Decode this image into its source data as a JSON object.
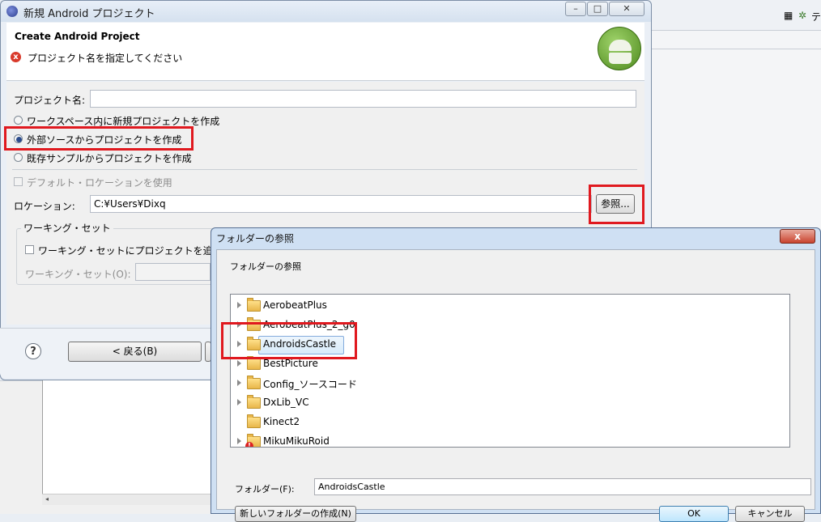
{
  "android_dialog": {
    "window_title": "新規 Android プロジェクト",
    "header_title": "Create Android Project",
    "header_error": "プロジェクト名を指定してください",
    "project_name_label": "プロジェクト名:",
    "project_name_value": "",
    "radio_options": [
      {
        "label": "ワークスペース内に新規プロジェクトを作成",
        "selected": false
      },
      {
        "label": "外部ソースからプロジェクトを作成",
        "selected": true
      },
      {
        "label": "既存サンプルからプロジェクトを作成",
        "selected": false
      }
    ],
    "use_default_location_label": "デフォルト・ロケーションを使用",
    "location_label": "ロケーション:",
    "location_value": "C:¥Users¥Dixq",
    "browse_button": "参照...",
    "working_set_group": "ワーキング・セット",
    "working_set_add_label": "ワーキング・セットにプロジェクトを追",
    "working_set_field_label": "ワーキング・セット(O):",
    "back_button": "< 戻る(B)",
    "window_buttons": {
      "minimize": "–",
      "maximize": "□",
      "close": "✕"
    }
  },
  "folder_dialog": {
    "window_title": "フォルダーの参照",
    "close_button": "x",
    "prompt": "フォルダーの参照",
    "tree_items": [
      {
        "label": "AerobeatPlus",
        "expandable": true,
        "selected": false
      },
      {
        "label": "AerobeatPlus_2_g0",
        "expandable": true,
        "selected": false
      },
      {
        "label": "AndroidsCastle",
        "expandable": true,
        "selected": true
      },
      {
        "label": "BestPicture",
        "expandable": true,
        "selected": false
      },
      {
        "label": "Config_ソースコード",
        "expandable": true,
        "selected": false
      },
      {
        "label": "DxLib_VC",
        "expandable": true,
        "selected": false
      },
      {
        "label": "Kinect2",
        "expandable": false,
        "selected": false
      },
      {
        "label": "MikuMikuRoid",
        "expandable": true,
        "selected": false
      }
    ],
    "folder_label": "フォルダー(F):",
    "folder_value": "AndroidsCastle",
    "new_folder_button": "新しいフォルダーの作成(N)",
    "ok_button": "OK",
    "cancel_button": "キャンセル"
  },
  "ide": {
    "toolbar_glyph": "テ"
  },
  "colors": {
    "highlight_red": "#e0191f",
    "selection_blue": "#84acdd"
  }
}
